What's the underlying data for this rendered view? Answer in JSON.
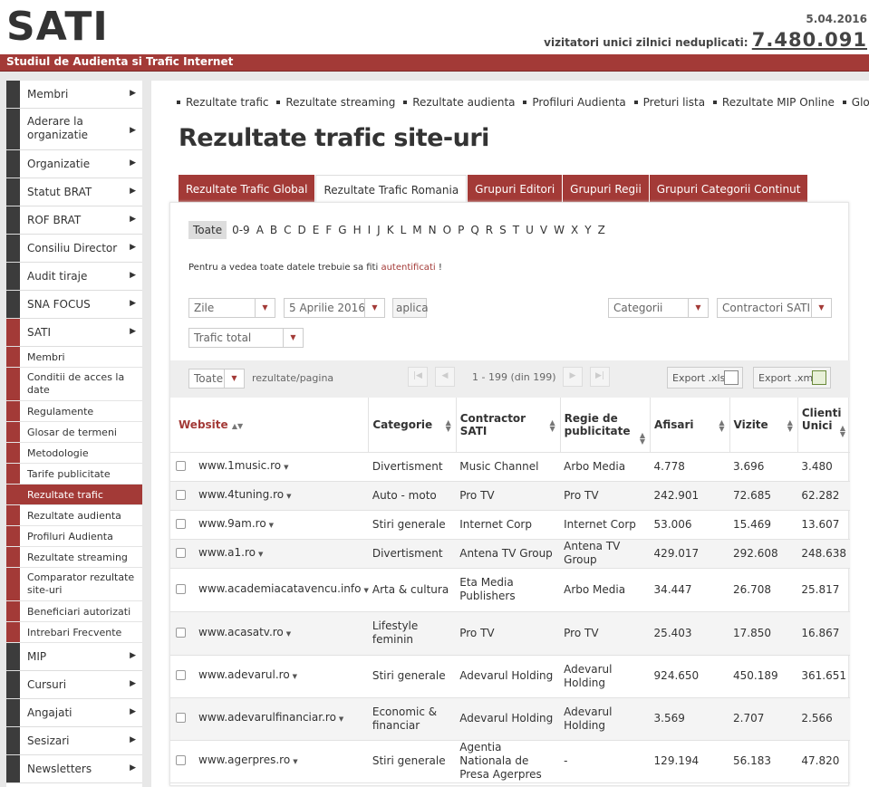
{
  "header": {
    "logo": "SATI",
    "date": "5.04.2016",
    "visitors_label": "vizitatori unici zilnici neduplicati:",
    "visitors_value": "7.480.091",
    "subtitle": "Studiul de Audienta si Trafic Internet"
  },
  "sidebar": {
    "items_top": [
      {
        "label": "Membri"
      },
      {
        "label": "Aderare la organizatie"
      },
      {
        "label": "Organizatie"
      },
      {
        "label": "Statut BRAT"
      },
      {
        "label": "ROF BRAT"
      },
      {
        "label": "Consiliu Director"
      },
      {
        "label": "Audit tiraje"
      },
      {
        "label": "SNA FOCUS"
      },
      {
        "label": "SATI"
      }
    ],
    "sati_sub": [
      {
        "label": "Membri"
      },
      {
        "label": "Conditii de acces la date"
      },
      {
        "label": "Regulamente"
      },
      {
        "label": "Glosar de termeni"
      },
      {
        "label": "Metodologie"
      },
      {
        "label": "Tarife publicitate"
      },
      {
        "label": "Rezultate trafic"
      },
      {
        "label": "Rezultate audienta"
      },
      {
        "label": "Profiluri Audienta"
      },
      {
        "label": "Rezultate streaming"
      },
      {
        "label": "Comparator rezultate site-uri"
      },
      {
        "label": "Beneficiari autorizati"
      },
      {
        "label": "Intrebari Frecvente"
      }
    ],
    "items_bottom": [
      {
        "label": "MIP"
      },
      {
        "label": "Cursuri"
      },
      {
        "label": "Angajati"
      },
      {
        "label": "Sesizari"
      },
      {
        "label": "Newsletters"
      }
    ]
  },
  "toplinks": [
    "Rezultate trafic",
    "Rezultate streaming",
    "Rezultate audienta",
    "Profiluri Audienta",
    "Preturi lista",
    "Rezultate MIP Online",
    "Glosar"
  ],
  "page_title": "Rezultate trafic site-uri",
  "tabs": [
    "Rezultate Trafic Global",
    "Rezultate Trafic Romania",
    "Grupuri Editori",
    "Grupuri Regii",
    "Grupuri Categorii Continut"
  ],
  "alphabet": [
    "Toate",
    "0-9",
    "A",
    "B",
    "C",
    "D",
    "E",
    "F",
    "G",
    "H",
    "I",
    "J",
    "K",
    "L",
    "M",
    "N",
    "O",
    "P",
    "Q",
    "R",
    "S",
    "T",
    "U",
    "V",
    "W",
    "X",
    "Y",
    "Z"
  ],
  "notice": {
    "before": "Pentru a vedea toate datele trebuie sa fiti ",
    "link": "autentificati",
    "after": " !"
  },
  "filters": {
    "period": "Zile",
    "date": "5 Aprilie 2016",
    "apply": "aplica",
    "category": "Categorii",
    "contractor": "Contractori SATI",
    "metric": "Trafic total"
  },
  "paging": {
    "per_page": "Toate",
    "per_page_label": "rezultate/pagina",
    "info": "1 - 199 (din 199)",
    "export_xls": "Export .xls",
    "export_xml": "Export .xml"
  },
  "table": {
    "headers": [
      "Website",
      "Categorie",
      "Contractor SATI",
      "Regie de publicitate",
      "Afisari",
      "Vizite",
      "Clienti Unici"
    ],
    "rows": [
      {
        "site": "www.1music.ro",
        "cat": "Divertisment",
        "contr": "Music Channel",
        "regie": "Arbo Media",
        "afisari": "4.778",
        "vizite": "3.696",
        "clienti": "3.480"
      },
      {
        "site": "www.4tuning.ro",
        "cat": "Auto - moto",
        "contr": "Pro TV",
        "regie": "Pro TV",
        "afisari": "242.901",
        "vizite": "72.685",
        "clienti": "62.282"
      },
      {
        "site": "www.9am.ro",
        "cat": "Stiri generale",
        "contr": "Internet Corp",
        "regie": "Internet Corp",
        "afisari": "53.006",
        "vizite": "15.469",
        "clienti": "13.607"
      },
      {
        "site": "www.a1.ro",
        "cat": "Divertisment",
        "contr": "Antena TV Group",
        "regie": "Antena TV Group",
        "afisari": "429.017",
        "vizite": "292.608",
        "clienti": "248.638"
      },
      {
        "site": "www.academiacatavencu.info",
        "cat": "Arta & cultura",
        "contr": "Eta Media Publishers",
        "regie": "Arbo Media",
        "afisari": "34.447",
        "vizite": "26.708",
        "clienti": "25.817"
      },
      {
        "site": "www.acasatv.ro",
        "cat": "Lifestyle feminin",
        "contr": "Pro TV",
        "regie": "Pro TV",
        "afisari": "25.403",
        "vizite": "17.850",
        "clienti": "16.867"
      },
      {
        "site": "www.adevarul.ro",
        "cat": "Stiri generale",
        "contr": "Adevarul Holding",
        "regie": "Adevarul Holding",
        "afisari": "924.650",
        "vizite": "450.189",
        "clienti": "361.651"
      },
      {
        "site": "www.adevarulfinanciar.ro",
        "cat": "Economic & financiar",
        "contr": "Adevarul Holding",
        "regie": "Adevarul Holding",
        "afisari": "3.569",
        "vizite": "2.707",
        "clienti": "2.566"
      },
      {
        "site": "www.agerpres.ro",
        "cat": "Stiri generale",
        "contr": "Agentia Nationala de Presa Agerpres",
        "regie": "-",
        "afisari": "129.194",
        "vizite": "56.183",
        "clienti": "47.820"
      }
    ]
  },
  "colors": {
    "brand": "#a33a37",
    "dark": "#3c3c3c"
  }
}
